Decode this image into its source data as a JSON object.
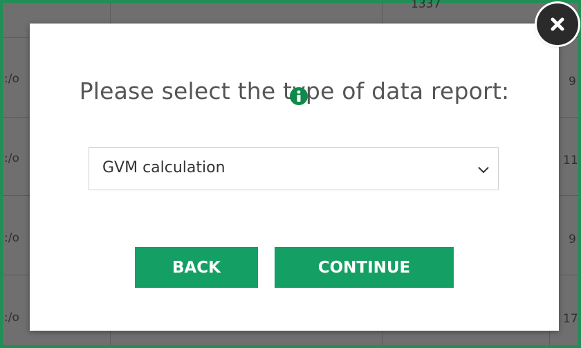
{
  "background": {
    "row_prefix": ":/o",
    "right_values": [
      "9",
      "11",
      "9",
      "17"
    ],
    "top_fragment": "1337"
  },
  "dialog": {
    "title": "Please select the type of data report:",
    "info_icon": "info-icon",
    "report_select": {
      "selected": "GVM calculation",
      "chevron_icon": "chevron-down-icon"
    },
    "back_label": "BACK",
    "continue_label": "CONTINUE",
    "close_icon": "close-icon"
  },
  "colors": {
    "accent": "#14a064",
    "info_icon": "#0f8a4a",
    "frame": "#1e8f55",
    "close_button": "#2a2a2a"
  }
}
